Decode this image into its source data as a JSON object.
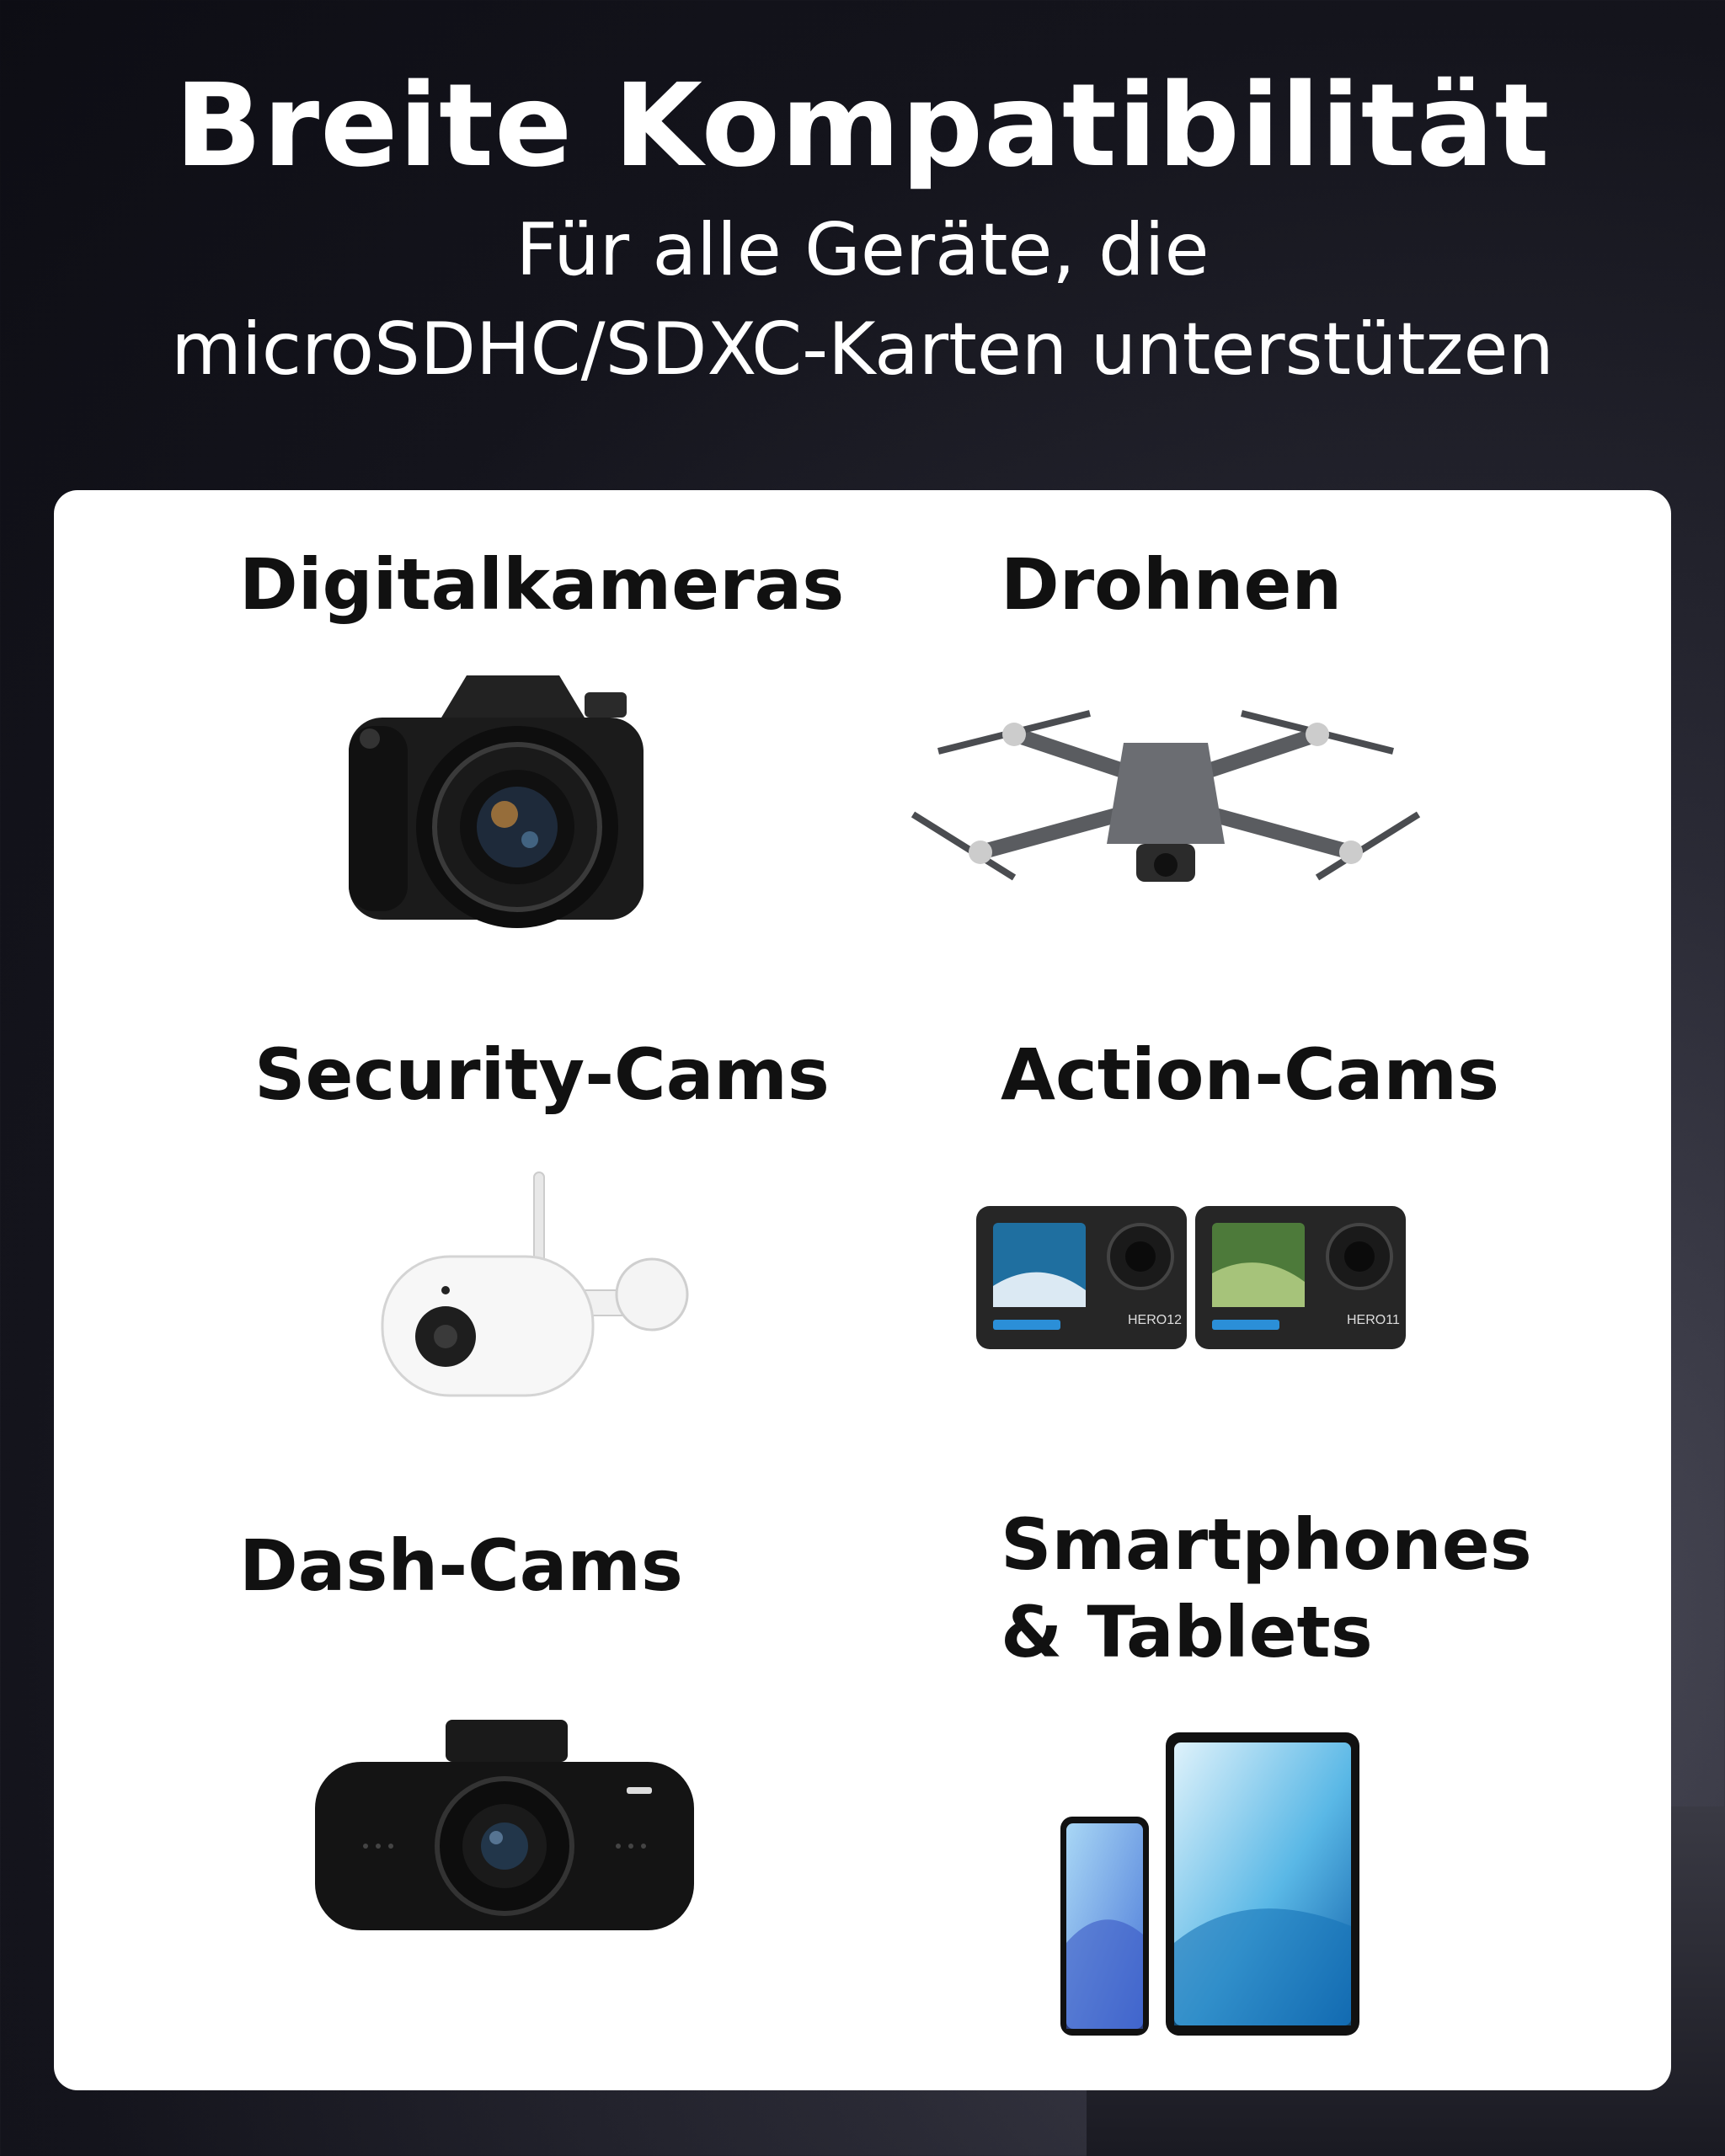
{
  "header": {
    "title": "Breite Kompatibilität",
    "subtitle_line1": "Für alle Geräte, die",
    "subtitle_line2": "microSDHC/SDXC-Karten unterstützen"
  },
  "devices": [
    {
      "label": "Digitalkameras",
      "icon": "dslr-camera-icon"
    },
    {
      "label": "Drohnen",
      "icon": "drone-icon"
    },
    {
      "label": "Security-Cams",
      "icon": "security-camera-icon"
    },
    {
      "label": "Action-Cams",
      "icon": "action-camera-icon"
    },
    {
      "label": "Dash-Cams",
      "icon": "dash-camera-icon"
    },
    {
      "label_line1": "Smartphones",
      "label_line2": "& Tablets",
      "icon": "phone-tablet-icon"
    }
  ],
  "action_cams": {
    "left_model": "HERO12",
    "right_model": "HERO11"
  },
  "colors": {
    "background": "#14141c",
    "card": "#ffffff",
    "text_dark": "#111111",
    "text_light": "#ffffff"
  }
}
